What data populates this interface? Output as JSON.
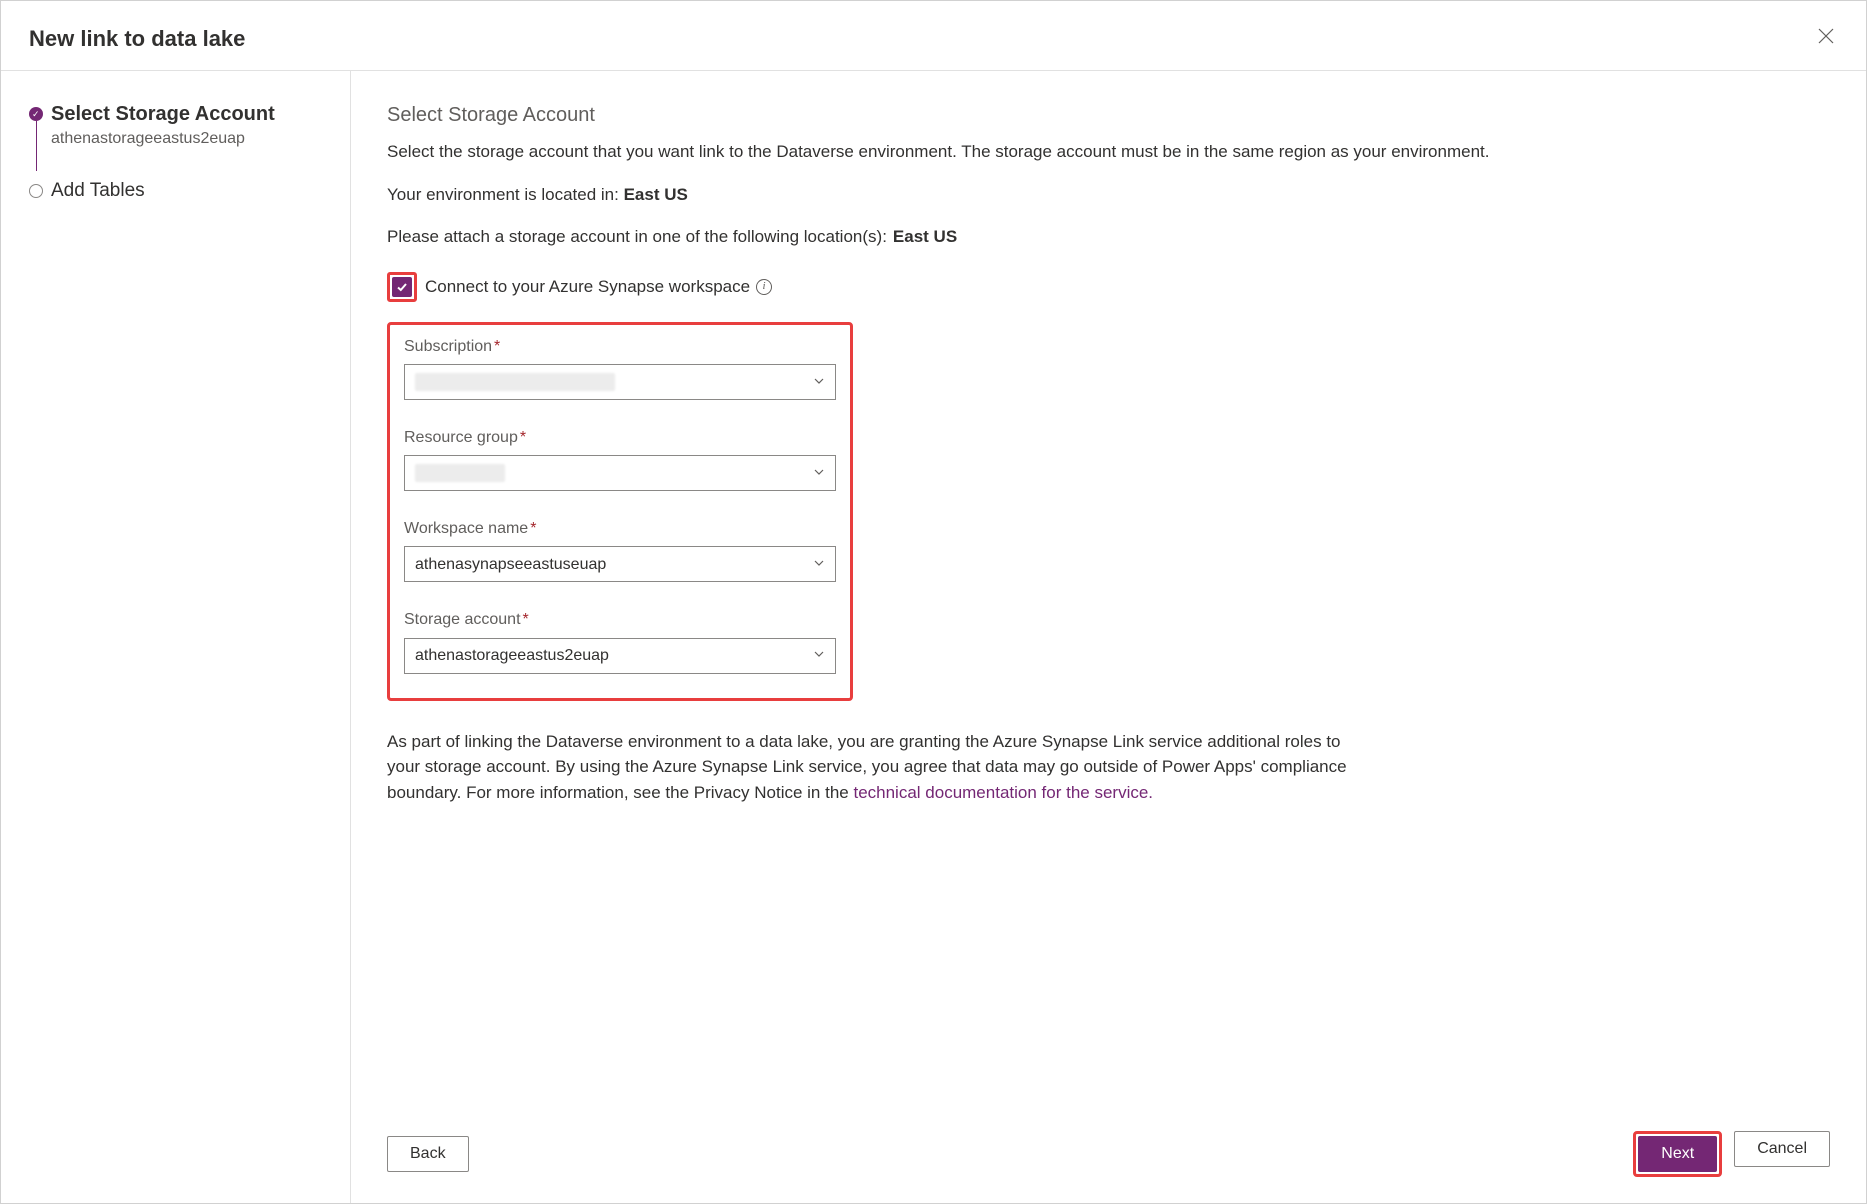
{
  "header": {
    "title": "New link to data lake"
  },
  "steps": {
    "select": {
      "title": "Select Storage Account",
      "subtitle": "athenastorageeastus2euap"
    },
    "add": {
      "title": "Add Tables"
    }
  },
  "main": {
    "section_title": "Select Storage Account",
    "description": "Select the storage account that you want link to the Dataverse environment. The storage account must be in the same region as your environment.",
    "env_prefix": "Your environment is located in: ",
    "env_region": "East US",
    "attach_prefix": "Please attach a storage account in one of the following location(s):",
    "attach_region": "East US",
    "checkbox_label": "Connect to your Azure Synapse workspace",
    "fields": {
      "subscription": {
        "label": "Subscription",
        "value": ""
      },
      "resource_group": {
        "label": "Resource group",
        "value": ""
      },
      "workspace": {
        "label": "Workspace name",
        "value": "athenasynapseeastuseuap"
      },
      "storage": {
        "label": "Storage account",
        "value": "athenastorageeastus2euap"
      }
    },
    "footer_text_1": "As part of linking the Dataverse environment to a data lake, you are granting the Azure Synapse Link service additional roles to your storage account. By using the Azure Synapse Link service, you agree that data may go outside of Power Apps' compliance boundary. For more information, see the Privacy Notice in the ",
    "footer_link": "technical documentation for the service.",
    "footer_text_2": ""
  },
  "buttons": {
    "back": "Back",
    "next": "Next",
    "cancel": "Cancel"
  }
}
